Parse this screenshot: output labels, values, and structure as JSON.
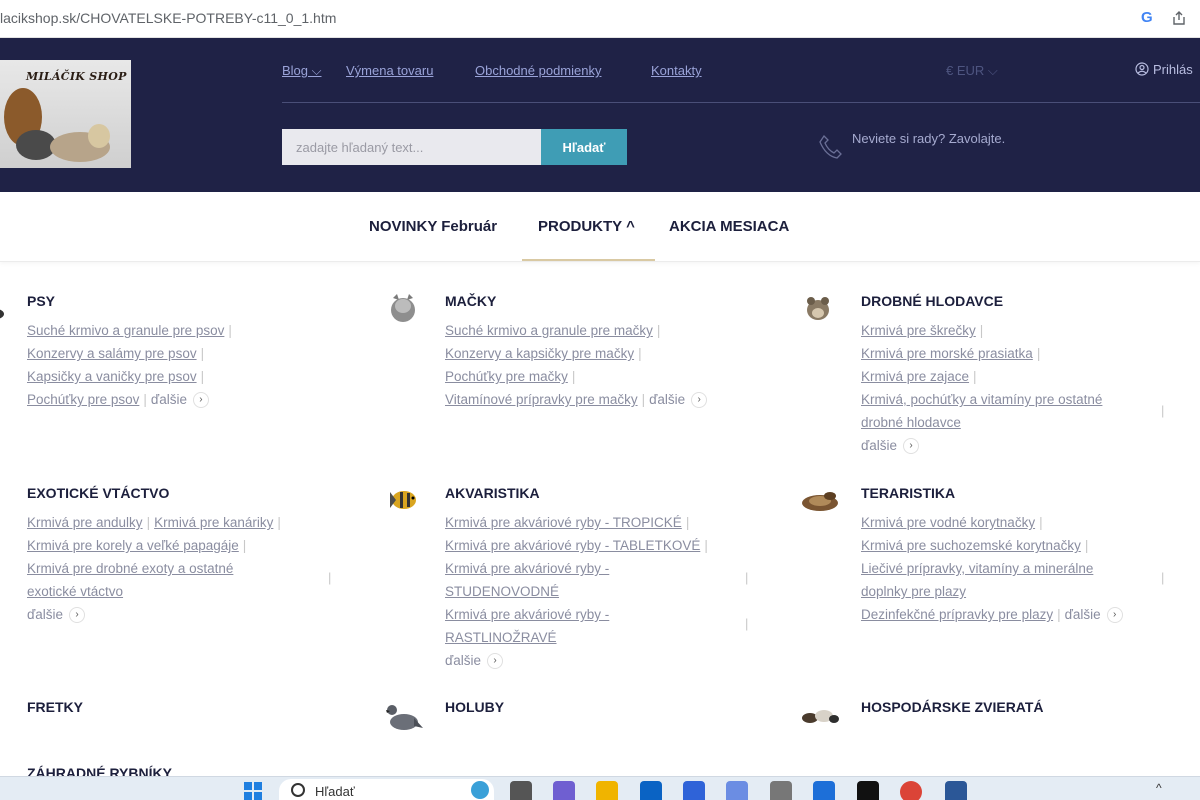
{
  "browser": {
    "url": "lacikshop.sk/CHOVATELSKE-POTREBY-c11_0_1.htm",
    "google_icon": "G"
  },
  "header": {
    "logo_text": "MILÁČIK SHOP",
    "topnav": [
      {
        "label": "Blog ⌵"
      },
      {
        "label": "Výmena tovaru"
      },
      {
        "label": "Obchodné podmienky"
      },
      {
        "label": "Kontakty"
      }
    ],
    "currency": "€  EUR ⌵",
    "login": "Prihlás",
    "search_placeholder": "zadajte hľadaný text...",
    "search_button": "Hľadať",
    "help_text": "Neviete si rady? Zavolajte."
  },
  "mainmenu": {
    "items": [
      {
        "label": "NOVINKY Február"
      },
      {
        "label": "PRODUKTY ^"
      },
      {
        "label": "AKCIA MESIACA"
      }
    ]
  },
  "categories": {
    "psy": {
      "title": "PSY",
      "links": [
        "Suché krmivo a granule pre psov",
        "Konzervy a salámy pre psov",
        "Kapsičky a vaničky pre psov",
        "Pochúťky pre psov"
      ],
      "more": "ďalšie"
    },
    "macky": {
      "title": "MAČKY",
      "links": [
        "Suché krmivo a granule pre mačky",
        "Konzervy a kapsičky pre mačky",
        "Pochúťky pre mačky",
        "Vitamínové prípravky pre mačky"
      ],
      "more": "ďalšie"
    },
    "hlodavce": {
      "title": "DROBNÉ HLODAVCE",
      "links": [
        "Krmivá pre škrečky",
        "Krmivá pre morské prasiatka",
        "Krmivá pre zajace",
        "Krmivá, pochúťky a vitamíny pre ostatné",
        "drobné hlodavce"
      ],
      "more": "ďalšie"
    },
    "vtactvo": {
      "title": "EXOTICKÉ VTÁCTVO",
      "links": [
        "Krmivá pre andulky",
        "Krmivá pre kanáriky",
        "Krmivá pre korely a veľké papagáje",
        "Krmivá pre drobné exoty a ostatné",
        "exotické vtáctvo"
      ],
      "more": "ďalšie"
    },
    "akvaristika": {
      "title": "AKVARISTIKA",
      "links": [
        "Krmivá pre akváriové ryby - TROPICKÉ",
        "Krmivá pre akváriové ryby - TABLETKOVÉ",
        "Krmivá pre akváriové ryby -",
        "STUDENOVODNÉ",
        "Krmivá pre akváriové ryby -",
        "RASTLINOŽRAVÉ"
      ],
      "more": "ďalšie"
    },
    "teraristika": {
      "title": "TERARISTIKA",
      "links": [
        "Krmivá pre vodné korytnačky",
        "Krmivá pre suchozemské korytnačky",
        "Liečivé prípravky, vitamíny a minerálne",
        "doplnky pre plazy",
        "Dezinfekčné prípravky pre plazy"
      ],
      "more": "ďalšie"
    },
    "fretky": {
      "title": "FRETKY"
    },
    "holuby": {
      "title": "HOLUBY"
    },
    "hospodarske": {
      "title": "HOSPODÁRSKE ZVIERATÁ"
    },
    "rybniky": {
      "title": "ZÁHRADNÉ RYBNÍKY"
    }
  },
  "taskbar": {
    "search_text": "Hľadať"
  },
  "colors": {
    "header_bg": "#1f2246",
    "accent": "#3f9db5",
    "active_underline": "#d9c9a3"
  }
}
